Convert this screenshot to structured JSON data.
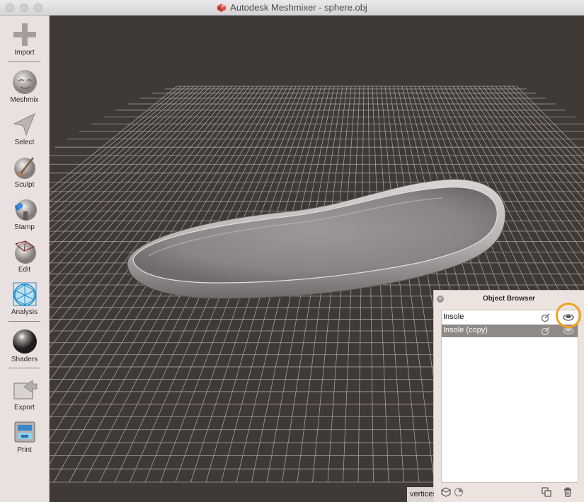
{
  "window": {
    "title": "Autodesk Meshmixer - sphere.obj",
    "traffic_lights": [
      "close-button",
      "minimize-button",
      "zoom-button"
    ]
  },
  "toolbar": {
    "items": [
      {
        "label": "Import",
        "icon": "plus-icon"
      },
      {
        "label": "Meshmix",
        "icon": "meshmix-head-icon"
      },
      {
        "label": "Select",
        "icon": "select-arrow-icon"
      },
      {
        "label": "Sculpt",
        "icon": "sculpt-brush-icon"
      },
      {
        "label": "Stamp",
        "icon": "stamp-icon"
      },
      {
        "label": "Edit",
        "icon": "edit-icon"
      },
      {
        "label": "Analysis",
        "icon": "analysis-icon"
      },
      {
        "label": "Shaders",
        "icon": "shaders-sphere-icon"
      },
      {
        "label": "Export",
        "icon": "export-icon"
      },
      {
        "label": "Print",
        "icon": "print-icon"
      }
    ]
  },
  "object_browser": {
    "title": "Object Browser",
    "objects": [
      {
        "name": "Insole",
        "selected": false
      },
      {
        "name": "Insole (copy)",
        "selected": true
      }
    ],
    "highlight_color": "#f1a21f"
  },
  "status_bar": {
    "text": "vertices"
  },
  "colors": {
    "viewport_background": "#3f3a36",
    "toolbar_background": "#e9e1df",
    "selected_row": "#8f8987"
  }
}
